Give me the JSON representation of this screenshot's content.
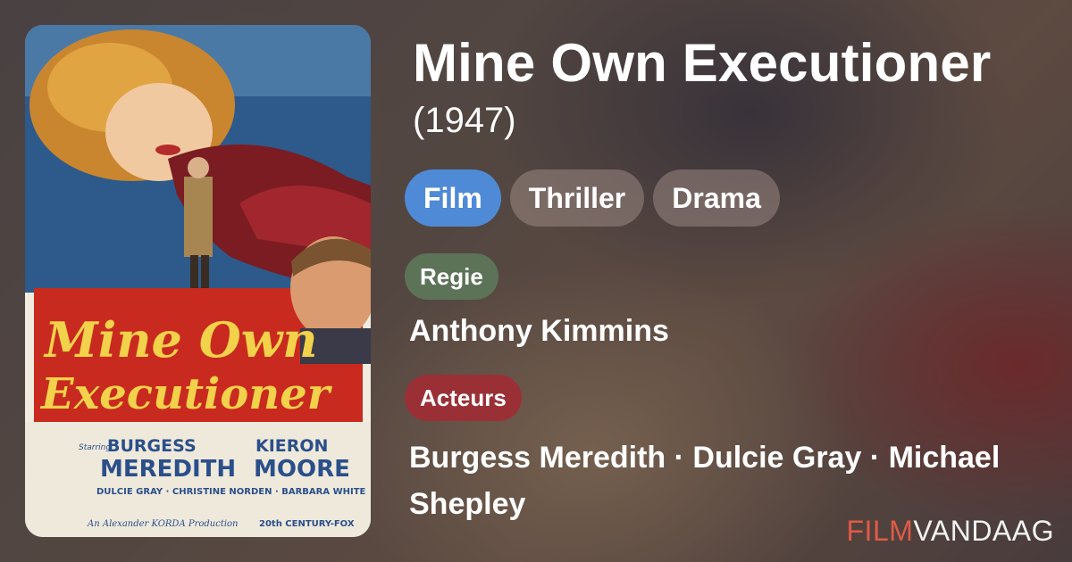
{
  "movie": {
    "title": "Mine Own Executioner",
    "year": "(1947)"
  },
  "tags": [
    "Film",
    "Thriller",
    "Drama"
  ],
  "director_label": "Regie",
  "director": "Anthony Kimmins",
  "actors_label": "Acteurs",
  "actors": "Burgess Meredith · Dulcie Gray · Michael Shepley",
  "poster": {
    "title_line1": "Mine Own",
    "title_line2": "Executioner",
    "starring": "Starring",
    "actor1_first": "BURGESS",
    "actor1_last": "MEREDITH",
    "actor2_first": "KIERON",
    "actor2_last": "MOORE",
    "supporting": "DULCIE GRAY · CHRISTINE NORDEN · BARBARA WHITE",
    "production": "An Alexander KORDA Production",
    "distributor": "20th CENTURY-FOX"
  },
  "logo": {
    "part1": "FILM",
    "part2": "VANDAAG"
  },
  "colors": {
    "tag_primary": "#4f8ad6",
    "regie_badge": "#5d7358",
    "acteurs_badge": "#9a3036",
    "logo_accent": "#e05a47"
  }
}
